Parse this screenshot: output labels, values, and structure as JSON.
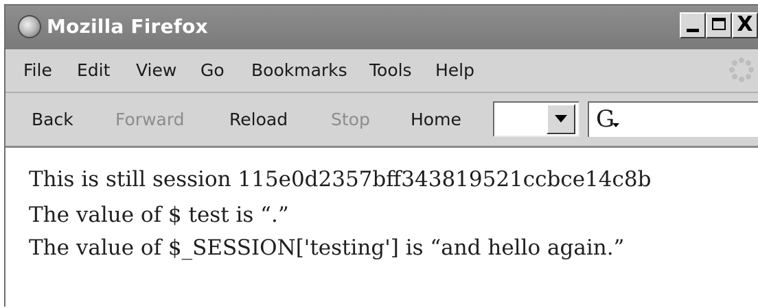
{
  "window": {
    "title": "Mozilla Firefox",
    "close_glyph": "X"
  },
  "menubar": {
    "items": [
      "File",
      "Edit",
      "View",
      "Go",
      "Bookmarks",
      "Tools",
      "Help"
    ]
  },
  "navbar": {
    "back": "Back",
    "forward": "Forward",
    "reload": "Reload",
    "stop": "Stop",
    "home": "Home",
    "address_value": "",
    "search_engine_letter": "G"
  },
  "content": {
    "line1": "This is still session 115e0d2357bff343819521ccbce14c8b",
    "line2": "The value of $ test is “.”",
    "line3": "The value of $_SESSION['testing'] is “and hello again.”"
  },
  "icons": {
    "app": "firefox-globe-icon",
    "throbber": "throbber-icon",
    "dropdown": "chevron-down-icon",
    "search": "google-search-icon"
  }
}
